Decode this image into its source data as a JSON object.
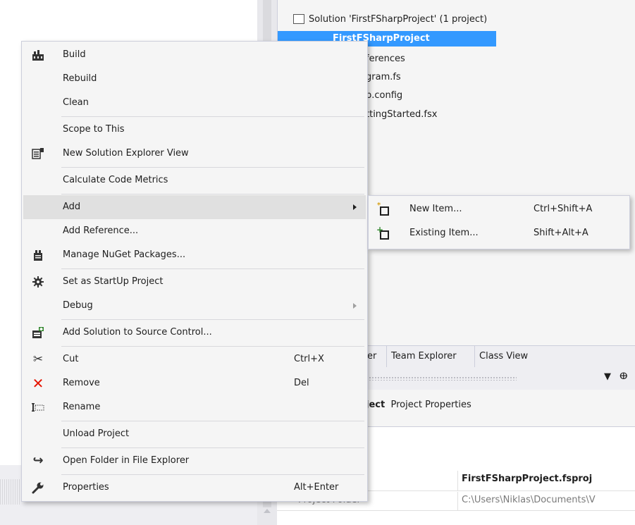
{
  "solution_explorer": {
    "rows": [
      {
        "label": "Solution 'FirstFSharpProject' (1 project)"
      },
      {
        "label": "FirstFSharpProject"
      },
      {
        "label": "ferences"
      },
      {
        "label": "gram.fs"
      },
      {
        "label": "p.config"
      },
      {
        "label": "ttingStarted.fsx"
      }
    ]
  },
  "tabs": {
    "tab1": "er",
    "tab2": "Team Explorer",
    "tab3": "Class View"
  },
  "properties": {
    "object_label_bold": "ject",
    "object_label_rest": "Project Properties",
    "rows": [
      {
        "name": "",
        "value": "FirstFSharpProject.fsproj"
      },
      {
        "name": "Project Folder",
        "value": "C:\\Users\\Niklas\\Documents\\V"
      }
    ]
  },
  "context_menu": {
    "items": [
      {
        "label": "Build",
        "icon": "build-icon"
      },
      {
        "label": "Rebuild"
      },
      {
        "label": "Clean"
      },
      {
        "label": "Scope to This"
      },
      {
        "label": "New Solution Explorer View",
        "icon": "new-view-icon"
      },
      {
        "label": "Calculate Code Metrics"
      },
      {
        "label": "Add"
      },
      {
        "label": "Add Reference..."
      },
      {
        "label": "Manage NuGet Packages...",
        "icon": "nuget-icon"
      },
      {
        "label": "Set as StartUp Project",
        "icon": "gear-icon"
      },
      {
        "label": "Debug"
      },
      {
        "label": "Add Solution to Source Control...",
        "icon": "source-control-icon"
      },
      {
        "label": "Cut",
        "shortcut": "Ctrl+X",
        "icon": "scissors-icon"
      },
      {
        "label": "Remove",
        "shortcut": "Del",
        "icon": "remove-icon"
      },
      {
        "label": "Rename",
        "icon": "rename-icon"
      },
      {
        "label": "Unload Project"
      },
      {
        "label": "Open Folder in File Explorer",
        "icon": "open-folder-icon"
      },
      {
        "label": "Properties",
        "shortcut": "Alt+Enter",
        "icon": "wrench-icon"
      }
    ]
  },
  "submenu": {
    "items": [
      {
        "label": "New Item...",
        "shortcut": "Ctrl+Shift+A",
        "icon": "new-item-icon"
      },
      {
        "label": "Existing Item...",
        "shortcut": "Shift+Alt+A",
        "icon": "existing-item-icon"
      }
    ]
  },
  "colors": {
    "selection": "#3399ff",
    "menu_bg": "#f5f5f5",
    "menu_highlight": "#e0e0e0",
    "remove_red": "#e51400"
  }
}
